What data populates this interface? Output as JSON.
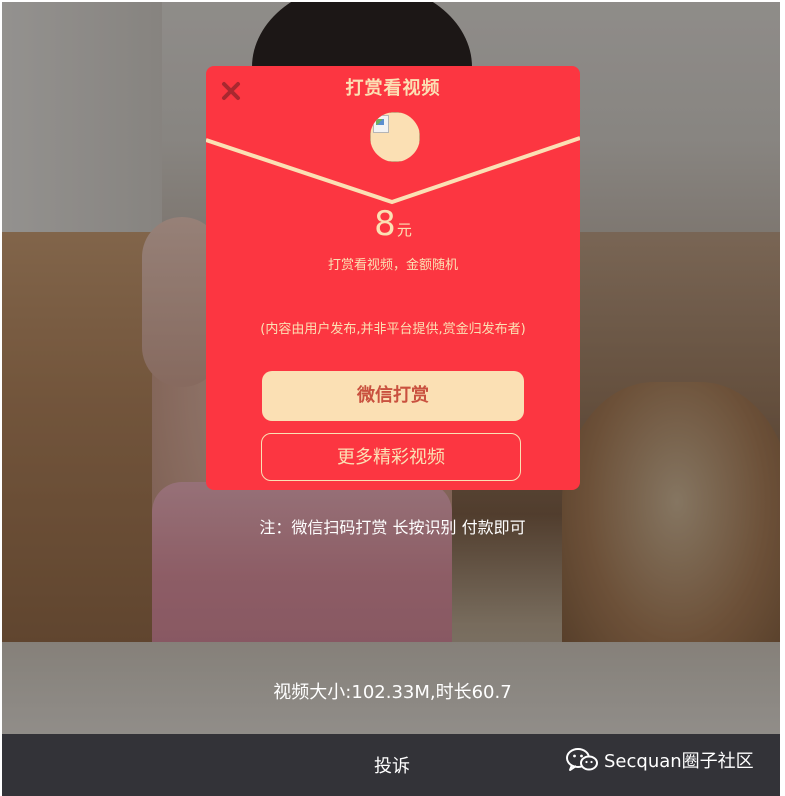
{
  "modal": {
    "title": "打赏看视频",
    "amount_value": "8",
    "amount_unit": "元",
    "subtitle": "打赏看视频，金额随机",
    "disclaimer": "(内容由用户发布,并非平台提供,赏金归发布者)",
    "wechat_button_label": "微信打赏",
    "more_videos_button_label": "更多精彩视频"
  },
  "note": "注：微信扫码打赏 长按识别 付款即可",
  "video_info": "视频大小:102.33M,时长60.7",
  "footer": {
    "complain_label": "投诉",
    "watermark_text": "Secquan圈子社区"
  },
  "colors": {
    "modal_bg": "#fc3641",
    "gold": "#fbe0b4",
    "footer_bg": "#333338"
  }
}
